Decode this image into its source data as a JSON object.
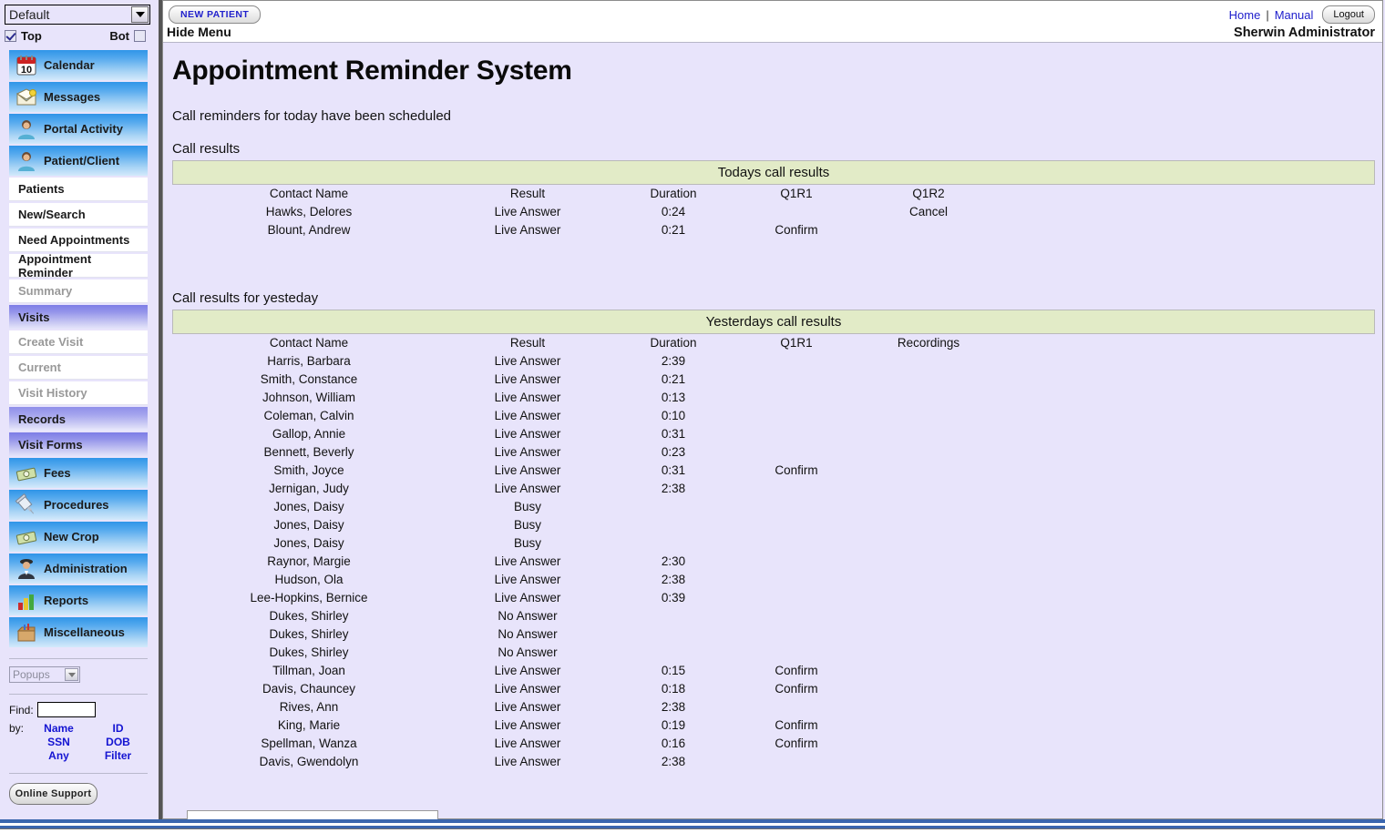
{
  "sidebar": {
    "profile_select": {
      "value": "Default",
      "icon": "chevron-down-icon"
    },
    "top_label": "Top",
    "bot_label": "Bot",
    "icon_items": [
      {
        "label": "Calendar",
        "icon": "calendar-icon"
      },
      {
        "label": "Messages",
        "icon": "envelope-icon"
      },
      {
        "label": "Portal Activity",
        "icon": "person-icon"
      },
      {
        "label": "Patient/Client",
        "icon": "person-icon"
      }
    ],
    "plain_items": [
      {
        "label": "Patients",
        "dim": false
      },
      {
        "label": "New/Search",
        "dim": false
      },
      {
        "label": "Need Appointments",
        "dim": false
      },
      {
        "label": "Appointment Reminder",
        "dim": false
      },
      {
        "label": "Summary",
        "dim": true
      }
    ],
    "visits_header": "Visits",
    "visits_items": [
      {
        "label": "Create Visit",
        "dim": true
      },
      {
        "label": "Current",
        "dim": true
      },
      {
        "label": "Visit History",
        "dim": true
      }
    ],
    "records_header": "Records",
    "visit_forms_header": "Visit Forms",
    "icon_items2": [
      {
        "label": "Fees",
        "icon": "money-icon"
      },
      {
        "label": "Procedures",
        "icon": "syringe-icon"
      },
      {
        "label": "New Crop",
        "icon": "money-icon"
      },
      {
        "label": "Administration",
        "icon": "admin-person-icon"
      },
      {
        "label": "Reports",
        "icon": "bar-chart-icon"
      },
      {
        "label": "Miscellaneous",
        "icon": "box-icon"
      }
    ],
    "popups_select": {
      "value": "Popups",
      "icon": "chevron-down-icon"
    },
    "find": {
      "label": "Find:",
      "value": "",
      "placeholder": ""
    },
    "by_label": "by:",
    "by_links": [
      "Name",
      "ID",
      "SSN",
      "DOB",
      "Any",
      "Filter"
    ],
    "online_support_label": "Online Support"
  },
  "topbar": {
    "new_patient_label": "NEW PATIENT",
    "hide_menu_label": "Hide Menu",
    "home_label": "Home",
    "separator": "|",
    "manual_label": "Manual",
    "logout_label": "Logout",
    "admin_name": "Sherwin Administrator"
  },
  "main": {
    "page_title": "Appointment Reminder System",
    "scheduled_message": "Call reminders for today have been scheduled",
    "today_section_label": "Call results",
    "today_bar_title": "Todays call results",
    "yesterday_section_label": "Call results for yesteday",
    "yesterday_bar_title": "Yesterdays call results"
  },
  "today_table": {
    "columns": [
      "Contact Name",
      "Result",
      "Duration",
      "Q1R1",
      "Q1R2"
    ],
    "rows": [
      {
        "name": "Hawks, Delores",
        "result": "Live Answer",
        "duration": "0:24",
        "q1r1": "",
        "q1r2": "Cancel"
      },
      {
        "name": "Blount, Andrew",
        "result": "Live Answer",
        "duration": "0:21",
        "q1r1": "Confirm",
        "q1r2": ""
      }
    ]
  },
  "yesterday_table": {
    "columns": [
      "Contact Name",
      "Result",
      "Duration",
      "Q1R1",
      "Recordings"
    ],
    "rows": [
      {
        "name": "Harris, Barbara",
        "result": "Live Answer",
        "duration": "2:39",
        "q1r1": "",
        "recordings": ""
      },
      {
        "name": "Smith, Constance",
        "result": "Live Answer",
        "duration": "0:21",
        "q1r1": "",
        "recordings": ""
      },
      {
        "name": "Johnson, William",
        "result": "Live Answer",
        "duration": "0:13",
        "q1r1": "",
        "recordings": ""
      },
      {
        "name": "Coleman, Calvin",
        "result": "Live Answer",
        "duration": "0:10",
        "q1r1": "",
        "recordings": ""
      },
      {
        "name": "Gallop, Annie",
        "result": "Live Answer",
        "duration": "0:31",
        "q1r1": "",
        "recordings": ""
      },
      {
        "name": "Bennett, Beverly",
        "result": "Live Answer",
        "duration": "0:23",
        "q1r1": "",
        "recordings": ""
      },
      {
        "name": "Smith, Joyce",
        "result": "Live Answer",
        "duration": "0:31",
        "q1r1": "Confirm",
        "recordings": ""
      },
      {
        "name": "Jernigan, Judy",
        "result": "Live Answer",
        "duration": "2:38",
        "q1r1": "",
        "recordings": ""
      },
      {
        "name": "Jones, Daisy",
        "result": "Busy",
        "duration": "",
        "q1r1": "",
        "recordings": ""
      },
      {
        "name": "Jones, Daisy",
        "result": "Busy",
        "duration": "",
        "q1r1": "",
        "recordings": ""
      },
      {
        "name": "Jones, Daisy",
        "result": "Busy",
        "duration": "",
        "q1r1": "",
        "recordings": ""
      },
      {
        "name": "Raynor, Margie",
        "result": "Live Answer",
        "duration": "2:30",
        "q1r1": "",
        "recordings": ""
      },
      {
        "name": "Hudson, Ola",
        "result": "Live Answer",
        "duration": "2:38",
        "q1r1": "",
        "recordings": ""
      },
      {
        "name": "Lee-Hopkins, Bernice",
        "result": "Live Answer",
        "duration": "0:39",
        "q1r1": "",
        "recordings": ""
      },
      {
        "name": "Dukes, Shirley",
        "result": "No Answer",
        "duration": "",
        "q1r1": "",
        "recordings": ""
      },
      {
        "name": "Dukes, Shirley",
        "result": "No Answer",
        "duration": "",
        "q1r1": "",
        "recordings": ""
      },
      {
        "name": "Dukes, Shirley",
        "result": "No Answer",
        "duration": "",
        "q1r1": "",
        "recordings": ""
      },
      {
        "name": "Tillman, Joan",
        "result": "Live Answer",
        "duration": "0:15",
        "q1r1": "Confirm",
        "recordings": ""
      },
      {
        "name": "Davis, Chauncey",
        "result": "Live Answer",
        "duration": "0:18",
        "q1r1": "Confirm",
        "recordings": ""
      },
      {
        "name": "Rives, Ann",
        "result": "Live Answer",
        "duration": "2:38",
        "q1r1": "",
        "recordings": ""
      },
      {
        "name": "King, Marie",
        "result": "Live Answer",
        "duration": "0:19",
        "q1r1": "Confirm",
        "recordings": ""
      },
      {
        "name": "Spellman, Wanza",
        "result": "Live Answer",
        "duration": "0:16",
        "q1r1": "Confirm",
        "recordings": ""
      },
      {
        "name": "Davis, Gwendolyn",
        "result": "Live Answer",
        "duration": "2:38",
        "q1r1": "",
        "recordings": ""
      }
    ]
  },
  "colors": {
    "page_background": "#e8e4fb",
    "green_header": "#e2ebc7",
    "link_blue": "#2020cc",
    "menu_blue": "#2f95e8",
    "menu_purple": "#7d7de6",
    "status_stripe": "#3a66ae"
  }
}
